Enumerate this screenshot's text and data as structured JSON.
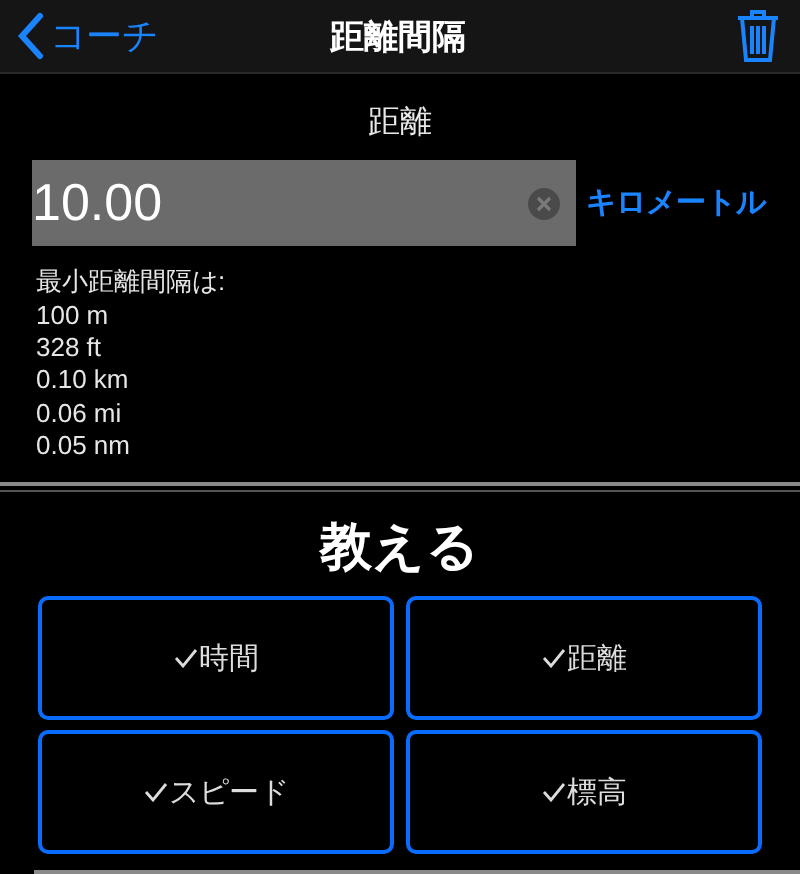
{
  "nav": {
    "back": "コーチ",
    "title": "距離間隔"
  },
  "distance": {
    "label": "距離",
    "value": "10.00",
    "unit": "キロメートル"
  },
  "minimum": {
    "heading": "最小距離間隔は:",
    "lines": [
      "100 m",
      "328 ft",
      "0.10 km",
      "0.06 mi",
      "0.05 nm"
    ]
  },
  "teach": {
    "title": "教える",
    "options": [
      {
        "label": "時間",
        "checked": true
      },
      {
        "label": "距離",
        "checked": true
      },
      {
        "label": "スピード",
        "checked": true
      },
      {
        "label": "標高",
        "checked": true
      }
    ]
  }
}
